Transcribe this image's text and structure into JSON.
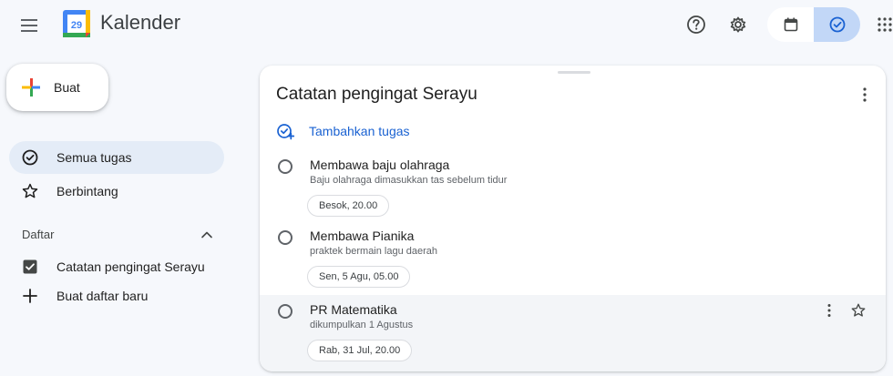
{
  "header": {
    "app_title": "Kalender",
    "logo_day": "29"
  },
  "sidebar": {
    "create_label": "Buat",
    "nav": [
      {
        "label": "Semua tugas",
        "icon": "check-circle-icon",
        "active": true
      },
      {
        "label": "Berbintang",
        "icon": "star-icon",
        "active": false
      }
    ],
    "lists_heading": "Daftar",
    "lists": [
      {
        "label": "Catatan pengingat Serayu",
        "checked": true
      }
    ],
    "new_list_label": "Buat daftar baru"
  },
  "main": {
    "list_title": "Catatan pengingat Serayu",
    "add_task_label": "Tambahkan tugas",
    "tasks": [
      {
        "title": "Membawa baju olahraga",
        "note": "Baju olahraga dimasukkan tas sebelum tidur",
        "due": "Besok, 20.00"
      },
      {
        "title": "Membawa Pianika",
        "note": "praktek bermain lagu daerah",
        "due": "Sen, 5 Agu, 05.00"
      },
      {
        "title": "PR Matematika",
        "note": "dikumpulkan 1 Agustus",
        "due": "Rab, 31 Jul, 20.00"
      }
    ]
  },
  "colors": {
    "accent": "#1a62d2",
    "active_nav": "#e4ecf7",
    "toggle_active": "#c2d7f7",
    "background": "#f6f8fc"
  }
}
